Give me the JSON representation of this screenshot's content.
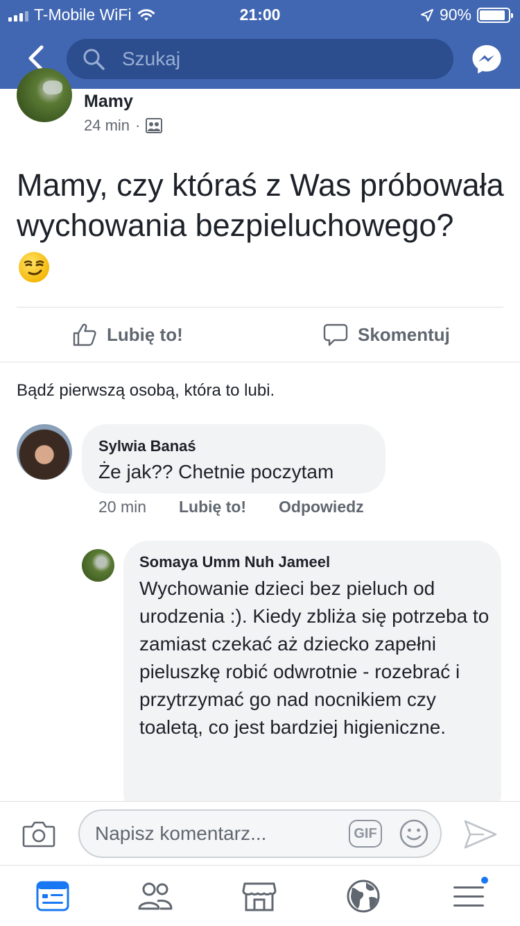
{
  "status_bar": {
    "carrier": "T-Mobile WiFi",
    "time": "21:00",
    "battery_percent": "90%",
    "battery_level": 0.9
  },
  "nav": {
    "back_icon": "chevron-left-icon",
    "search_placeholder": "Szukaj",
    "messenger_icon": "messenger-icon"
  },
  "post": {
    "author": "Mamy",
    "time": "24 min",
    "separator": "·",
    "audience_icon": "group-icon",
    "text": "Mamy, czy któraś z Was próbowała wychowania bezpieluchowego?",
    "emoji_icon": "smirking-face-icon"
  },
  "actions": {
    "like_label": "Lubię to!",
    "comment_label": "Skomentuj"
  },
  "likes_summary": "Bądź pierwszą osobą, która to lubi.",
  "comments": [
    {
      "author": "Sylwia Banaś",
      "text": "Że jak?? Chetnie poczytam",
      "time": "20 min",
      "like_label": "Lubię to!",
      "reply_label": "Odpowiedz"
    },
    {
      "author": "Somaya Umm Nuh Jameel",
      "text": "Wychowanie dzieci bez pieluch od urodzenia :). Kiedy zbliża się potrzeba to zamiast czekać aż dziecko zapełni pieluszkę robić odwrotnie - rozebrać i przytrzymać go nad nocnikiem czy toaletą, co jest bardziej higieniczne."
    }
  ],
  "composer": {
    "placeholder": "Napisz komentarz...",
    "gif_label": "GIF"
  },
  "tabbar": {
    "items": [
      "news-feed-icon",
      "friends-icon",
      "marketplace-icon",
      "globe-icon",
      "menu-icon"
    ],
    "accent": "#1877f2"
  },
  "colors": {
    "brand": "#4267b2",
    "secondary_text": "#606770",
    "bubble": "#f2f3f5"
  }
}
